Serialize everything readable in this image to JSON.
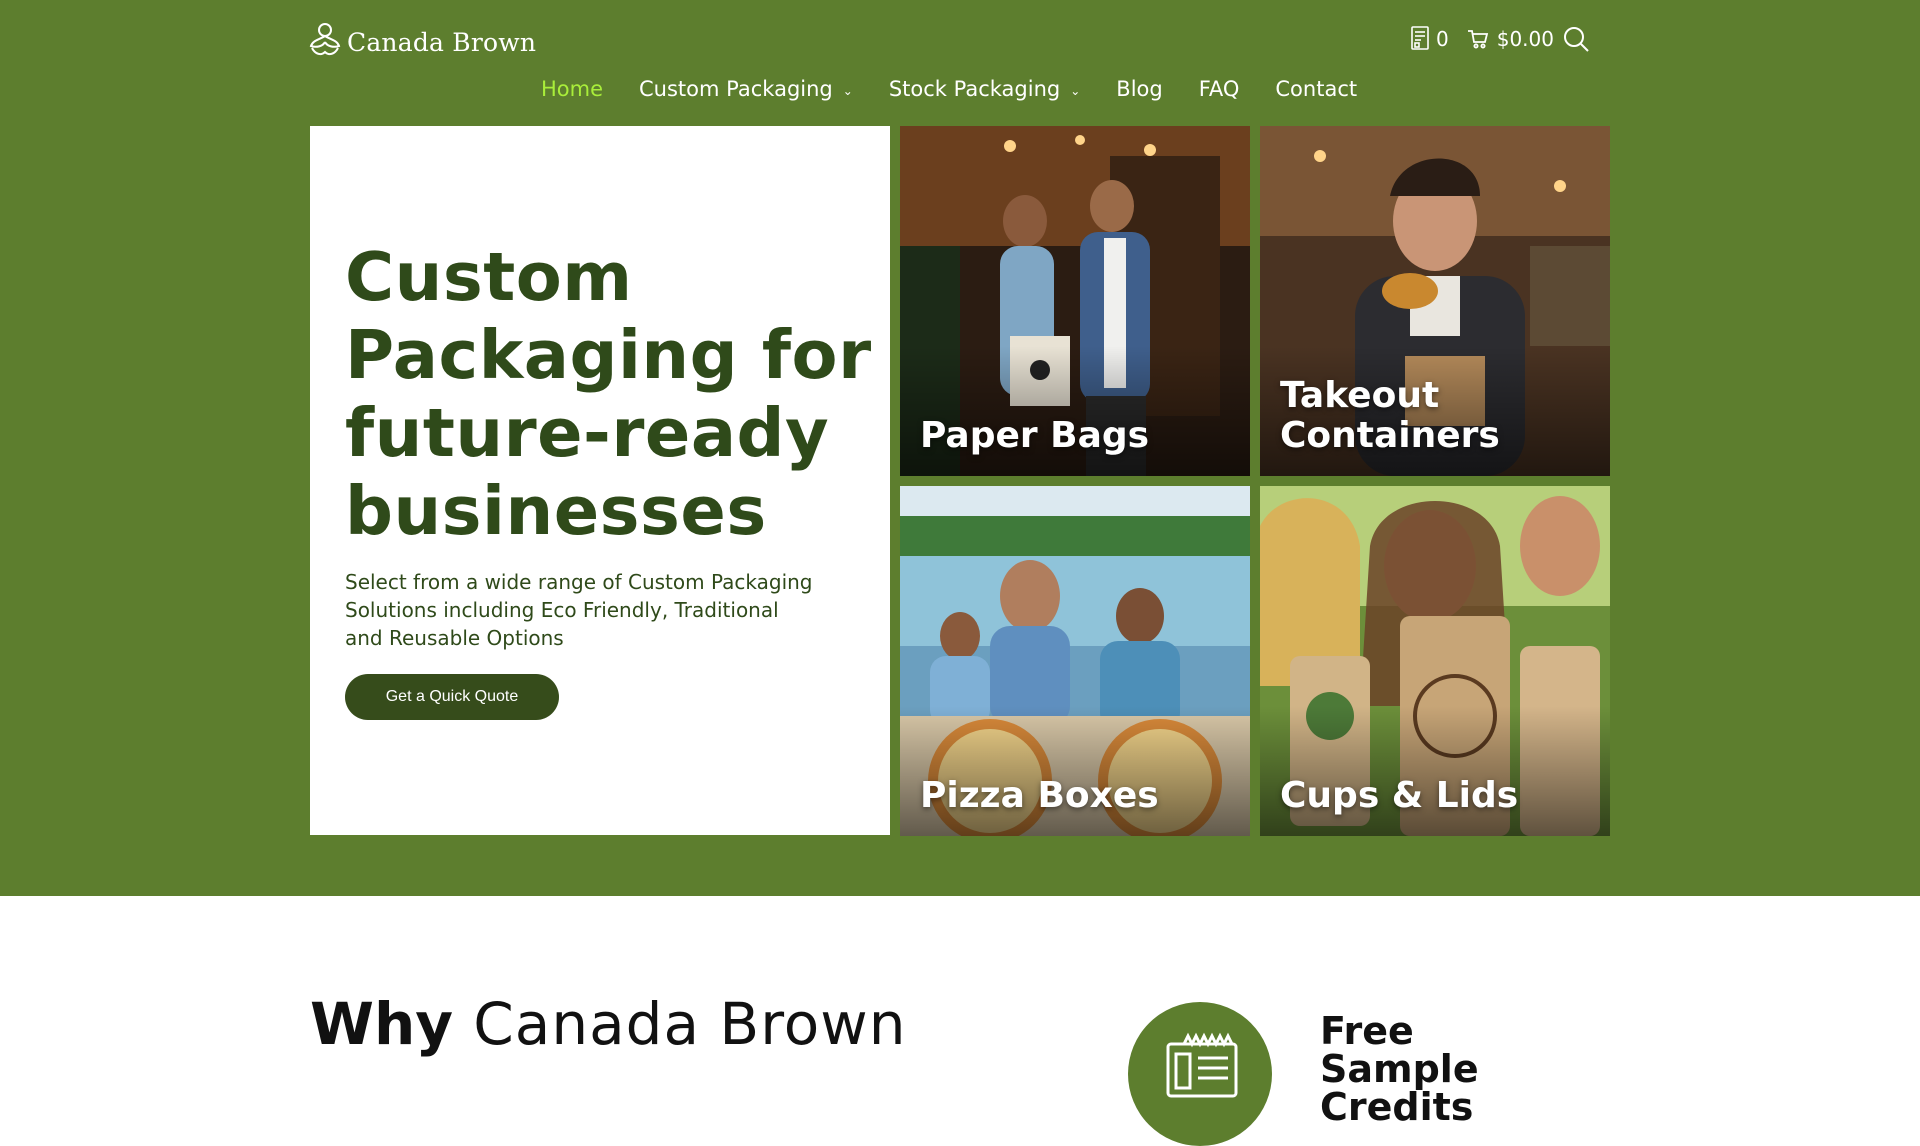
{
  "brand": {
    "name": "Canada Brown",
    "logo_icon": "leaf-logo-icon"
  },
  "header": {
    "quote_icon": "quote-list-icon",
    "quote_count": "0",
    "cart_icon": "cart-icon",
    "cart_total": "$0.00",
    "search_icon": "search-icon"
  },
  "nav": {
    "items": [
      {
        "label": "Home",
        "active": true,
        "has_dropdown": false
      },
      {
        "label": "Custom Packaging",
        "has_dropdown": true
      },
      {
        "label": "Stock Packaging",
        "has_dropdown": true
      },
      {
        "label": "Blog",
        "has_dropdown": false
      },
      {
        "label": "FAQ",
        "has_dropdown": false
      },
      {
        "label": "Contact",
        "has_dropdown": false
      }
    ]
  },
  "hero": {
    "title": "Custom Packaging for future-ready businesses",
    "subtitle": "Select from a wide range of Custom Packaging Solutions including Eco Friendly, Traditional and Reusable Options",
    "cta": "Get a Quick Quote",
    "tiles": [
      {
        "label": "Paper Bags"
      },
      {
        "label": "Takeout Containers"
      },
      {
        "label": "Pizza Boxes"
      },
      {
        "label": "Cups & Lids"
      }
    ]
  },
  "why": {
    "title_bold": "Why",
    "title_light": "Canada Brown",
    "feature": {
      "title": "Free Sample Credits",
      "icon": "receipt-icon"
    }
  },
  "colors": {
    "brand_green": "#5d7e2e",
    "dark_green": "#2f4a1a",
    "button": "#364c1b",
    "active_nav": "#a9ee3a"
  }
}
